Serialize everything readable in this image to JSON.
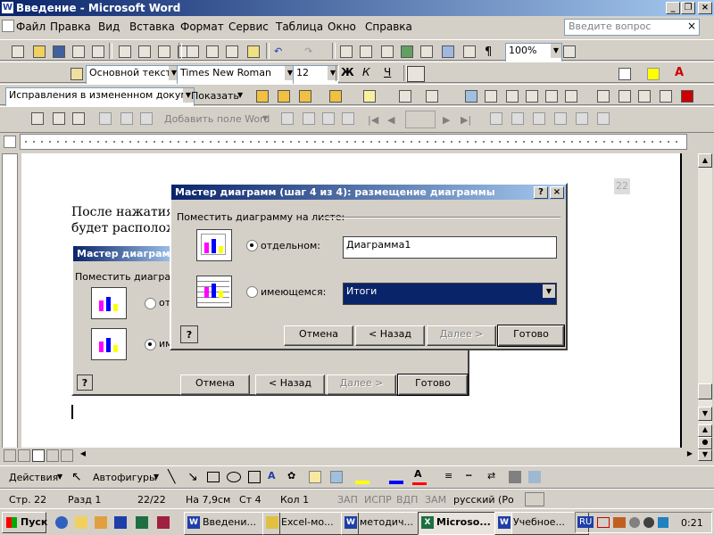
{
  "window": {
    "title": "Введение - Microsoft Word",
    "icon": "W"
  },
  "menu": [
    "Файл",
    "Правка",
    "Вид",
    "Вставка",
    "Формат",
    "Сервис",
    "Таблица",
    "Окно",
    "Справка"
  ],
  "ask_placeholder": "Введите вопрос",
  "format_toolbar": {
    "style": "Основной текст",
    "font": "Times New Roman",
    "size": "12",
    "zoom": "100%"
  },
  "review_toolbar": {
    "mode": "Исправления в измененном документ",
    "show": "Показать"
  },
  "mail_toolbar": {
    "add_field": "Добавить поле Word"
  },
  "document": {
    "line1": "После нажатия н",
    "line2": "будет располож",
    "page_num": "22"
  },
  "bg_dialog": {
    "title": "Мастер диаграмм (",
    "place_label": "Поместить диаграмм",
    "opt1": "от",
    "opt2": "им",
    "cancel": "Отмена",
    "back": "< Назад",
    "next": "Далее >",
    "finish": "Готово"
  },
  "dialog": {
    "title": "Мастер диаграмм (шаг 4 из 4): размещение диаграммы",
    "place_label": "Поместить диаграмму на листе:",
    "opt_separate": "отдельном:",
    "opt_existing": "имеющемся:",
    "separate_value": "Диаграмма1",
    "existing_value": "Итоги",
    "cancel": "Отмена",
    "back": "< Назад",
    "next": "Далее >",
    "finish": "Готово"
  },
  "draw_toolbar": {
    "actions": "Действия",
    "autoshapes": "Автофигуры"
  },
  "status": {
    "page": "Стр. 22",
    "section": "Разд 1",
    "pages": "22/22",
    "at": "На 7,9см",
    "line": "Ст 4",
    "col": "Кол 1",
    "rec": "ЗАП",
    "trk": "ИСПР",
    "ext": "ВДП",
    "ovr": "ЗАМ",
    "lang": "русский (Ро"
  },
  "taskbar": {
    "start": "Пуск",
    "tasks": [
      "Введени...",
      "Excel-мо...",
      "методич...",
      "Microso...",
      "Учебное..."
    ],
    "lang": "RU",
    "time": "0:21"
  },
  "colors": {
    "title_start": "#0a246a",
    "title_end": "#a6caf0",
    "chrome": "#d4d0c8"
  }
}
